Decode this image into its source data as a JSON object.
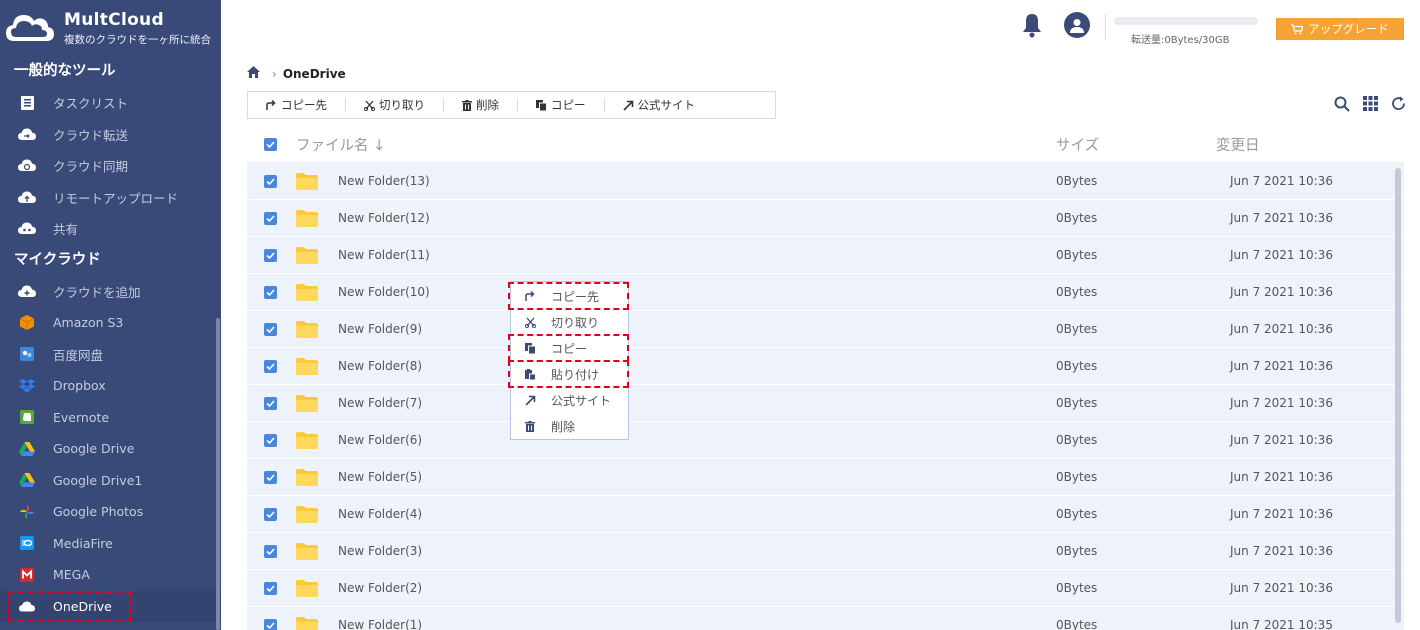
{
  "brand": {
    "name": "MultCloud",
    "subtitle": "複数のクラウドを一ヶ所に統合"
  },
  "sidebar": {
    "tools_title": "一般的なツール",
    "tools": [
      {
        "label": "タスクリスト",
        "icon": "task-list-icon"
      },
      {
        "label": "クラウド転送",
        "icon": "cloud-transfer-icon"
      },
      {
        "label": "クラウド同期",
        "icon": "cloud-sync-icon"
      },
      {
        "label": "リモートアップロード",
        "icon": "remote-upload-icon"
      },
      {
        "label": "共有",
        "icon": "share-icon"
      }
    ],
    "clouds_title": "マイクラウド",
    "clouds": [
      {
        "label": "クラウドを追加",
        "icon": "add-cloud-icon",
        "color": "#ffffff"
      },
      {
        "label": "Amazon S3",
        "icon": "amazon-s3-icon",
        "color": "#f29100"
      },
      {
        "label": "百度网盘",
        "icon": "baidu-icon",
        "color": "#3d86e0"
      },
      {
        "label": "Dropbox",
        "icon": "dropbox-icon",
        "color": "#0d62ff"
      },
      {
        "label": "Evernote",
        "icon": "evernote-icon",
        "color": "#57a83b"
      },
      {
        "label": "Google Drive",
        "icon": "google-drive-icon",
        "color": "#1fa463"
      },
      {
        "label": "Google Drive1",
        "icon": "google-drive-icon",
        "color": "#1fa463"
      },
      {
        "label": "Google Photos",
        "icon": "google-photos-icon",
        "color": "#ea4335"
      },
      {
        "label": "MediaFire",
        "icon": "mediafire-icon",
        "color": "#1299f3"
      },
      {
        "label": "MEGA",
        "icon": "mega-icon",
        "color": "#d9272e"
      },
      {
        "label": "OneDrive",
        "icon": "onedrive-icon",
        "color": "#2e7be4",
        "active": true
      }
    ]
  },
  "topbar": {
    "transfer_text": "転送量:0Bytes/30GB",
    "transfer_fraction": 0,
    "upgrade_label": "アップグレード"
  },
  "breadcrumb": {
    "current": "OneDrive"
  },
  "toolbar": {
    "copy_to": "コピー先",
    "cut": "切り取り",
    "delete": "削除",
    "copy": "コピー",
    "official_site": "公式サイト"
  },
  "table": {
    "col_name": "ファイル名",
    "col_size": "サイズ",
    "col_date": "変更日",
    "rows": [
      {
        "name": "New Folder(13)",
        "size": "0Bytes",
        "date": "Jun 7 2021 10:36"
      },
      {
        "name": "New Folder(12)",
        "size": "0Bytes",
        "date": "Jun 7 2021 10:36"
      },
      {
        "name": "New Folder(11)",
        "size": "0Bytes",
        "date": "Jun 7 2021 10:36"
      },
      {
        "name": "New Folder(10)",
        "size": "0Bytes",
        "date": "Jun 7 2021 10:36"
      },
      {
        "name": "New Folder(9)",
        "size": "0Bytes",
        "date": "Jun 7 2021 10:36"
      },
      {
        "name": "New Folder(8)",
        "size": "0Bytes",
        "date": "Jun 7 2021 10:36"
      },
      {
        "name": "New Folder(7)",
        "size": "0Bytes",
        "date": "Jun 7 2021 10:36"
      },
      {
        "name": "New Folder(6)",
        "size": "0Bytes",
        "date": "Jun 7 2021 10:36"
      },
      {
        "name": "New Folder(5)",
        "size": "0Bytes",
        "date": "Jun 7 2021 10:36"
      },
      {
        "name": "New Folder(4)",
        "size": "0Bytes",
        "date": "Jun 7 2021 10:36"
      },
      {
        "name": "New Folder(3)",
        "size": "0Bytes",
        "date": "Jun 7 2021 10:36"
      },
      {
        "name": "New Folder(2)",
        "size": "0Bytes",
        "date": "Jun 7 2021 10:36"
      },
      {
        "name": "New Folder(1)",
        "size": "0Bytes",
        "date": "Jun 7 2021 10:35"
      }
    ]
  },
  "context_menu": {
    "items": [
      {
        "label": "コピー先",
        "icon": "copy-to-icon",
        "highlighted": true
      },
      {
        "label": "切り取り",
        "icon": "cut-icon",
        "highlighted": false
      },
      {
        "label": "コピー",
        "icon": "copy-icon",
        "highlighted": true
      },
      {
        "label": "貼り付け",
        "icon": "paste-icon",
        "highlighted": true
      },
      {
        "label": "公式サイト",
        "icon": "official-site-icon",
        "highlighted": false
      },
      {
        "label": "削除",
        "icon": "delete-icon",
        "highlighted": false
      }
    ]
  },
  "colors": {
    "sidebar": "#3a4a78",
    "accent": "#4a86dc",
    "upgrade": "#f7a234",
    "row": "#eef3fb",
    "highlight": "#e3001b"
  }
}
